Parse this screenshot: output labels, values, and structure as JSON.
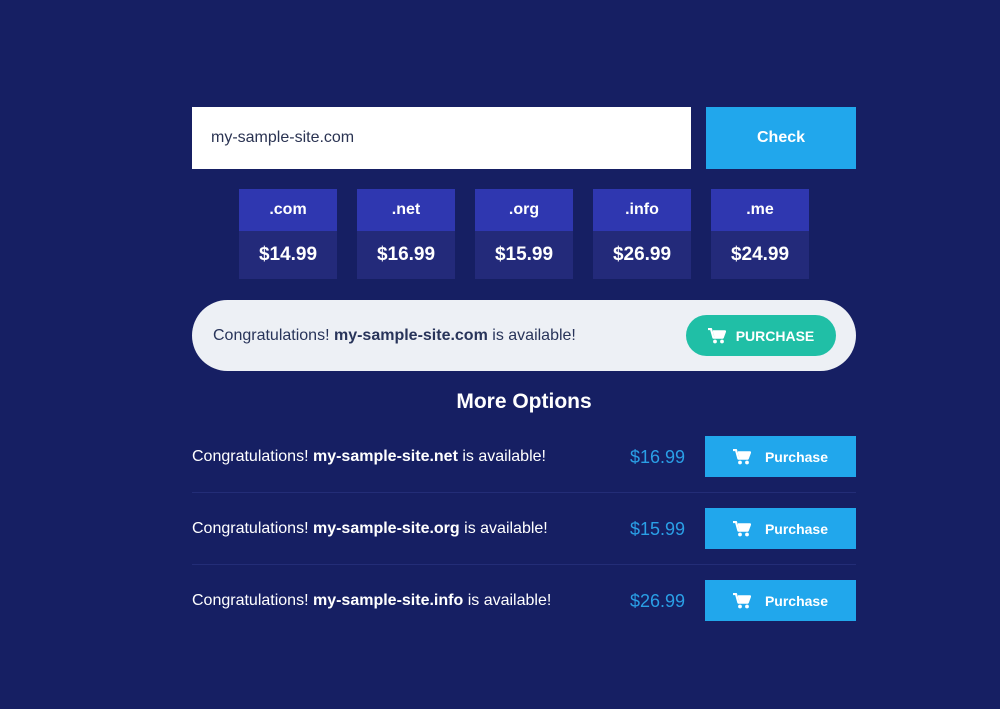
{
  "search": {
    "value": "my-sample-site.com",
    "check_label": "Check"
  },
  "tlds": [
    {
      "name": ".com",
      "price": "$14.99"
    },
    {
      "name": ".net",
      "price": "$16.99"
    },
    {
      "name": ".org",
      "price": "$15.99"
    },
    {
      "name": ".info",
      "price": "$26.99"
    },
    {
      "name": ".me",
      "price": "$24.99"
    }
  ],
  "result": {
    "prefix": "Congratulations!",
    "domain": "my-sample-site.com",
    "suffix": "is available!",
    "purchase_label": "PURCHASE"
  },
  "more_options": {
    "title": "More Options",
    "items": [
      {
        "prefix": "Congratulations!",
        "domain": "my-sample-site.net",
        "suffix": "is available!",
        "price": "$16.99",
        "button_label": "Purchase"
      },
      {
        "prefix": "Congratulations!",
        "domain": "my-sample-site.org",
        "suffix": "is available!",
        "price": "$15.99",
        "button_label": "Purchase"
      },
      {
        "prefix": "Congratulations!",
        "domain": "my-sample-site.info",
        "suffix": "is available!",
        "price": "$26.99",
        "button_label": "Purchase"
      }
    ]
  },
  "icons": {
    "cart": "shopping-cart-icon"
  },
  "colors": {
    "background": "#161f63",
    "accent": "#21a7ec",
    "purchase_green": "#20bfa6",
    "tld_header": "#2f37b0",
    "tld_body": "#232a7a",
    "price_blue": "#2a9fe6"
  }
}
